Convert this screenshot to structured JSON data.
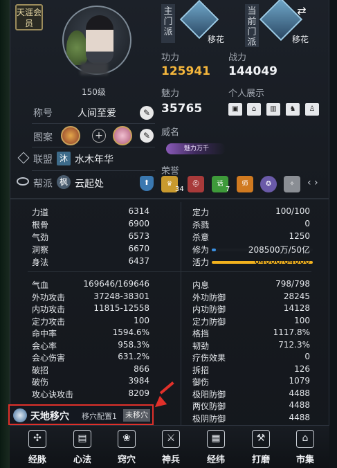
{
  "profile": {
    "badge": "天涯会员",
    "level": "150级",
    "title_label": "称号",
    "title_value": "人间至爱",
    "pattern_label": "图案",
    "alliance_label": "联盟",
    "alliance_tag": "沐",
    "alliance_value": "水木年华",
    "guild_label": "帮派",
    "guild_tag": "枫",
    "guild_value": "云起处"
  },
  "school": {
    "main_label": "主门派",
    "main_name": "移花",
    "current_label": "当前门派",
    "current_name": "移花"
  },
  "summary": {
    "gongli_label": "功力",
    "gongli_value": "125941",
    "zhanli_label": "战力",
    "zhanli_value": "144049",
    "meili_label": "魅力",
    "meili_value": "35765",
    "display_label": "个人展示",
    "weiming_label": "威名",
    "weiming_title": "魅力万千",
    "honor_label": "荣誉",
    "honor_counts": [
      "34",
      "7"
    ],
    "honor_letters": [
      "话",
      "师"
    ]
  },
  "attributes_left": [
    {
      "k": "力道",
      "v": "6314"
    },
    {
      "k": "根骨",
      "v": "6900"
    },
    {
      "k": "气劲",
      "v": "6573"
    },
    {
      "k": "洞察",
      "v": "6670"
    },
    {
      "k": "身法",
      "v": "6437"
    }
  ],
  "attributes_right": [
    {
      "k": "定力",
      "v": "100/100"
    },
    {
      "k": "杀戮",
      "v": "0"
    },
    {
      "k": "杀意",
      "v": "1250"
    },
    {
      "k": "修为",
      "v": "208500万/50亿"
    },
    {
      "k": "活力",
      "v": "64000/64000"
    }
  ],
  "combat_left": [
    {
      "k": "气血",
      "v": "169646/169646"
    },
    {
      "k": "外功攻击",
      "v": "37248-38301"
    },
    {
      "k": "内功攻击",
      "v": "11815-12558"
    },
    {
      "k": "定力攻击",
      "v": "100"
    },
    {
      "k": "命中率",
      "v": "1594.6%"
    },
    {
      "k": "会心率",
      "v": "958.3%"
    },
    {
      "k": "会心伤害",
      "v": "631.2%"
    },
    {
      "k": "破招",
      "v": "866"
    },
    {
      "k": "破伤",
      "v": "3984"
    },
    {
      "k": "攻心诀攻击",
      "v": "8209"
    }
  ],
  "combat_right": [
    {
      "k": "内息",
      "v": "798/798"
    },
    {
      "k": "外功防御",
      "v": "28245"
    },
    {
      "k": "内功防御",
      "v": "14128"
    },
    {
      "k": "定力防御",
      "v": "100"
    },
    {
      "k": "格挡",
      "v": "1117.8%"
    },
    {
      "k": "韧劲",
      "v": "712.3%"
    },
    {
      "k": "疗伤效果",
      "v": "0"
    },
    {
      "k": "拆招",
      "v": "126"
    },
    {
      "k": "御伤",
      "v": "1079"
    },
    {
      "k": "极阳防御",
      "v": "4488"
    },
    {
      "k": "两仪防御",
      "v": "4488"
    },
    {
      "k": "极阴防御",
      "v": "4488"
    }
  ],
  "bars": {
    "xiuwei_fill": 0.04,
    "huoli_fill": 1.0,
    "xiuwei_color": "#3a8fe0",
    "huoli_color": "#f2b21e"
  },
  "shifting": {
    "title": "天地移穴",
    "config": "移穴配置1",
    "state": "未移穴",
    "highlight_color": "#e0302a"
  },
  "tabs": [
    {
      "label": "经脉",
      "icon": "meridian-icon"
    },
    {
      "label": "心法",
      "icon": "book-icon"
    },
    {
      "label": "窍穴",
      "icon": "lotus-icon"
    },
    {
      "label": "神兵",
      "icon": "sword-icon"
    },
    {
      "label": "经纬",
      "icon": "grid-icon"
    },
    {
      "label": "打磨",
      "icon": "hammer-icon"
    },
    {
      "label": "市集",
      "icon": "market-icon"
    }
  ]
}
